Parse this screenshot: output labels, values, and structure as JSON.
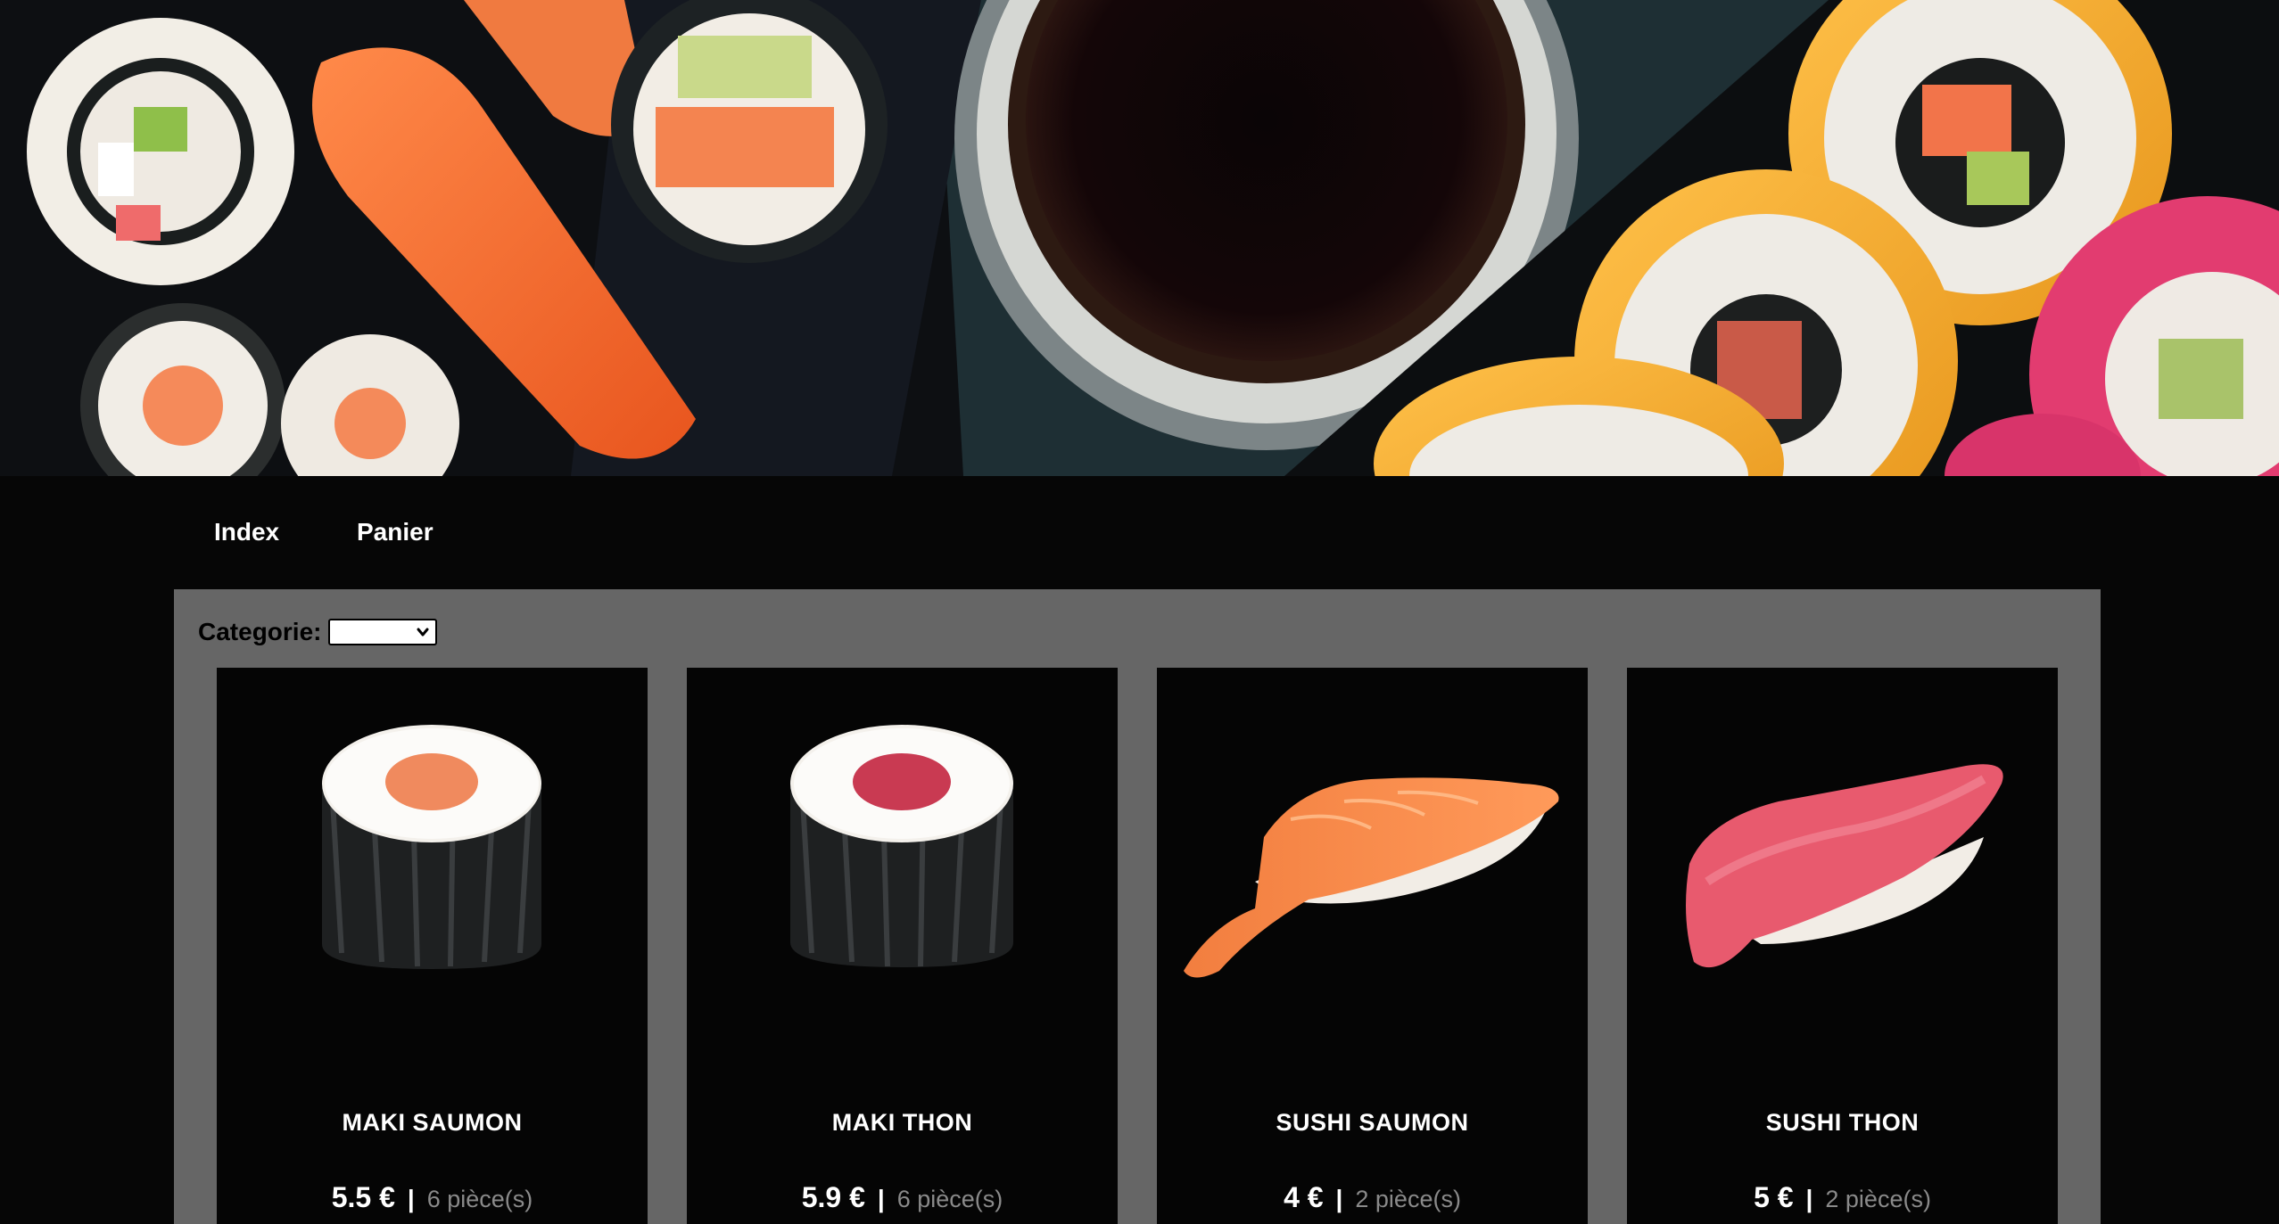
{
  "nav": {
    "items": [
      {
        "label": "Index"
      },
      {
        "label": "Panier"
      }
    ]
  },
  "filter": {
    "label": "Categorie:",
    "selected": ""
  },
  "products": [
    {
      "name": "MAKI SAUMON",
      "price": "5.5 €",
      "separator": "|",
      "pieces": "6 pièce(s)"
    },
    {
      "name": "MAKI THON",
      "price": "5.9 €",
      "separator": "|",
      "pieces": "6 pièce(s)"
    },
    {
      "name": "SUSHI SAUMON",
      "price": "4 €",
      "separator": "|",
      "pieces": "2 pièce(s)"
    },
    {
      "name": "SUSHI THON",
      "price": "5 €",
      "separator": "|",
      "pieces": "2 pièce(s)"
    }
  ],
  "colors": {
    "page_bg": "#060606",
    "panel_bg": "#666666",
    "card_bg": "#050505",
    "text": "#ffffff",
    "muted_text": "#8a8a8a"
  }
}
